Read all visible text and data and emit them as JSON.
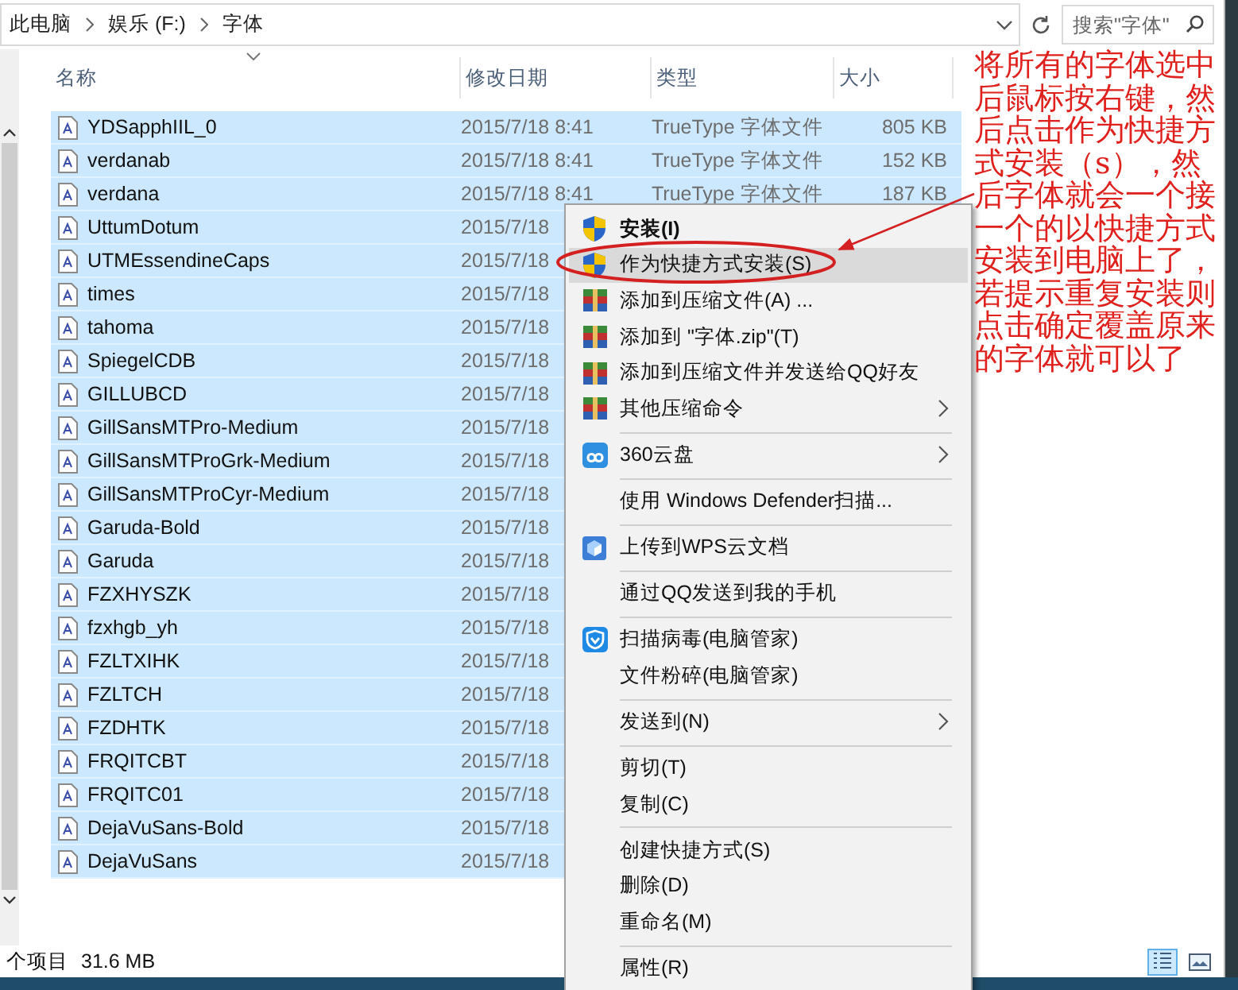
{
  "address_bar": {
    "path": [
      {
        "label": "此电脑"
      },
      {
        "label": "娱乐 (F:)"
      },
      {
        "label": "字体"
      }
    ]
  },
  "search": {
    "placeholder": "搜索\"字体\""
  },
  "columns": [
    "名称",
    "修改日期",
    "类型",
    "大小"
  ],
  "files": [
    {
      "name": "YDSapphIIL_0",
      "date": "2015/7/18 8:41",
      "type": "TrueType 字体文件",
      "size": "805 KB",
      "selected": true
    },
    {
      "name": "verdanab",
      "date": "2015/7/18 8:41",
      "type": "TrueType 字体文件",
      "size": "152 KB",
      "selected": true
    },
    {
      "name": "verdana",
      "date": "2015/7/18 8:41",
      "type": "TrueType 字体文件",
      "size": "187 KB",
      "selected": true
    },
    {
      "name": "UttumDotum",
      "date": "2015/7/18",
      "selected": true
    },
    {
      "name": "UTMEssendineCaps",
      "date": "2015/7/18",
      "selected": true
    },
    {
      "name": "times",
      "date": "2015/7/18",
      "selected": true
    },
    {
      "name": "tahoma",
      "date": "2015/7/18",
      "selected": true
    },
    {
      "name": "SpiegelCDB",
      "date": "2015/7/18",
      "selected": true
    },
    {
      "name": "GILLUBCD",
      "date": "2015/7/18",
      "selected": true
    },
    {
      "name": "GillSansMTPro-Medium",
      "date": "2015/7/18",
      "selected": true
    },
    {
      "name": "GillSansMTProGrk-Medium",
      "date": "2015/7/18",
      "selected": true
    },
    {
      "name": "GillSansMTProCyr-Medium",
      "date": "2015/7/18",
      "selected": true
    },
    {
      "name": "Garuda-Bold",
      "date": "2015/7/18",
      "selected": true
    },
    {
      "name": "Garuda",
      "date": "2015/7/18",
      "selected": true
    },
    {
      "name": "FZXHYSZK",
      "date": "2015/7/18",
      "selected": true
    },
    {
      "name": "fzxhgb_yh",
      "date": "2015/7/18",
      "selected": true
    },
    {
      "name": "FZLTXIHK",
      "date": "2015/7/18",
      "selected": true
    },
    {
      "name": "FZLTCH",
      "date": "2015/7/18",
      "selected": true
    },
    {
      "name": "FZDHTK",
      "date": "2015/7/18",
      "selected": true
    },
    {
      "name": "FRQITCBT",
      "date": "2015/7/18",
      "selected": true
    },
    {
      "name": "FRQITC01",
      "date": "2015/7/18",
      "selected": true
    },
    {
      "name": "DejaVuSans-Bold",
      "date": "2015/7/18",
      "selected": true
    },
    {
      "name": "DejaVuSans",
      "date": "2015/7/18",
      "selected": true
    }
  ],
  "context_menu": {
    "items": [
      {
        "kind": "shield",
        "label": "安装(I)",
        "bold": true,
        "selected": false,
        "submenu": false
      },
      {
        "kind": "shield",
        "label": "作为快捷方式安装(S)",
        "bold": false,
        "selected": true,
        "submenu": false
      },
      {
        "kind": "archive",
        "label": "添加到压缩文件(A) ...",
        "bold": false,
        "selected": false,
        "submenu": false
      },
      {
        "kind": "archive",
        "label": "添加到 \"字体.zip\"(T)",
        "bold": false,
        "selected": false,
        "submenu": false
      },
      {
        "kind": "archive",
        "label": "添加到压缩文件并发送给QQ好友",
        "bold": false,
        "selected": false,
        "submenu": false
      },
      {
        "kind": "archive",
        "label": "其他压缩命令",
        "bold": false,
        "selected": false,
        "submenu": true
      },
      {
        "kind": "separator"
      },
      {
        "kind": "cloud",
        "label": "360云盘",
        "bold": false,
        "selected": false,
        "submenu": true
      },
      {
        "kind": "separator"
      },
      {
        "kind": "plain",
        "label": "使用 Windows Defender扫描...",
        "bold": false,
        "selected": false,
        "submenu": false
      },
      {
        "kind": "separator"
      },
      {
        "kind": "cube",
        "label": "上传到WPS云文档",
        "bold": false,
        "selected": false,
        "submenu": false
      },
      {
        "kind": "separator"
      },
      {
        "kind": "plain",
        "label": "通过QQ发送到我的手机",
        "bold": false,
        "selected": false,
        "submenu": false
      },
      {
        "kind": "separator"
      },
      {
        "kind": "guard",
        "label": "扫描病毒(电脑管家)",
        "bold": false,
        "selected": false,
        "submenu": false
      },
      {
        "kind": "plain",
        "label": "文件粉碎(电脑管家)",
        "bold": false,
        "selected": false,
        "submenu": false
      },
      {
        "kind": "separator"
      },
      {
        "kind": "plain",
        "label": "发送到(N)",
        "bold": false,
        "selected": false,
        "submenu": true
      },
      {
        "kind": "separator"
      },
      {
        "kind": "plain",
        "label": "剪切(T)",
        "bold": false,
        "selected": false,
        "submenu": false
      },
      {
        "kind": "plain",
        "label": "复制(C)",
        "bold": false,
        "selected": false,
        "submenu": false
      },
      {
        "kind": "separator"
      },
      {
        "kind": "plain",
        "label": "创建快捷方式(S)",
        "bold": false,
        "selected": false,
        "submenu": false
      },
      {
        "kind": "plain",
        "label": "删除(D)",
        "bold": false,
        "selected": false,
        "submenu": false
      },
      {
        "kind": "plain",
        "label": "重命名(M)",
        "bold": false,
        "selected": false,
        "submenu": false
      },
      {
        "kind": "separator"
      },
      {
        "kind": "plain",
        "label": "属性(R)",
        "bold": false,
        "selected": false,
        "submenu": false
      }
    ]
  },
  "status_bar": {
    "count": "个项目",
    "size": "31.6 MB"
  },
  "annotation": {
    "text": "将所有的字体选中后鼠标按右键，然后点击作为快捷方式安装（s），然后字体就会一个接一个的以快捷方式安装到电脑上了，若提示重复安装则点击确定覆盖原来的字体就可以了"
  }
}
